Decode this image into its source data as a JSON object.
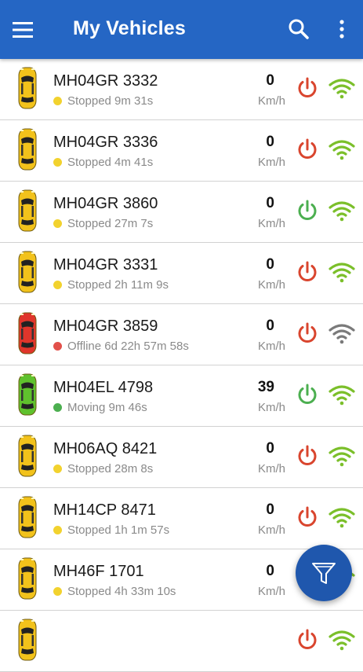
{
  "app_bar": {
    "title": "My Vehicles",
    "menu_icon": "hamburger-menu-icon",
    "search_icon": "search-icon",
    "more_icon": "more-vertical-icon",
    "color": "#2566c4"
  },
  "speed_unit": "Km/h",
  "status_colors": {
    "stopped": "#f2d22e",
    "offline": "#e2504a",
    "moving": "#4caf50"
  },
  "vehicles": [
    {
      "plate": "MH04GR 3332",
      "status": "Stopped 9m 31s",
      "state": "stopped",
      "speed": "0",
      "ignition": "off",
      "signal": "good",
      "car_color": "#f2c21b"
    },
    {
      "plate": "MH04GR 3336",
      "status": "Stopped 4m 41s",
      "state": "stopped",
      "speed": "0",
      "ignition": "off",
      "signal": "good",
      "car_color": "#f2c21b"
    },
    {
      "plate": "MH04GR 3860",
      "status": "Stopped 27m 7s",
      "state": "stopped",
      "speed": "0",
      "ignition": "on",
      "signal": "good",
      "car_color": "#f2c21b"
    },
    {
      "plate": "MH04GR 3331",
      "status": "Stopped 2h 11m 9s",
      "state": "stopped",
      "speed": "0",
      "ignition": "off",
      "signal": "good",
      "car_color": "#f2c21b"
    },
    {
      "plate": "MH04GR 3859",
      "status": "Offline 6d 22h 57m 58s",
      "state": "offline",
      "speed": "0",
      "ignition": "off",
      "signal": "none",
      "car_color": "#e0352b"
    },
    {
      "plate": "MH04EL 4798",
      "status": "Moving 9m 46s",
      "state": "moving",
      "speed": "39",
      "ignition": "on",
      "signal": "good",
      "car_color": "#5fc12d"
    },
    {
      "plate": "MH06AQ 8421",
      "status": "Stopped 28m 8s",
      "state": "stopped",
      "speed": "0",
      "ignition": "off",
      "signal": "good",
      "car_color": "#f2c21b"
    },
    {
      "plate": "MH14CP 8471",
      "status": "Stopped 1h 1m 57s",
      "state": "stopped",
      "speed": "0",
      "ignition": "off",
      "signal": "good",
      "car_color": "#f2c21b"
    },
    {
      "plate": "MH46F 1701",
      "status": "Stopped 4h 33m 10s",
      "state": "stopped",
      "speed": "0",
      "ignition": "off",
      "signal": "good",
      "car_color": "#f2c21b"
    },
    {
      "plate": "",
      "status": "",
      "state": "stopped",
      "speed": "",
      "ignition": "off",
      "signal": "good",
      "car_color": "#f2c21b"
    }
  ],
  "fab": {
    "icon": "filter-funnel-icon"
  }
}
